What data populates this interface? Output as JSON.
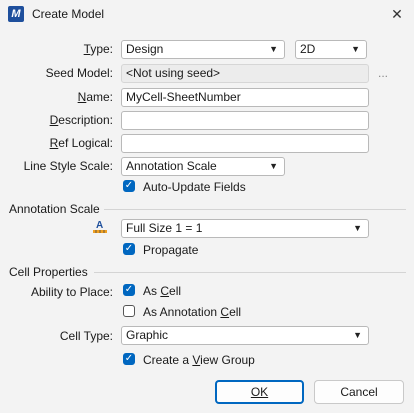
{
  "window": {
    "title": "Create Model",
    "app_icon": "microstation-icon",
    "close_glyph": "✕"
  },
  "fields": {
    "type_label": "Type:",
    "type_value": "Design",
    "dim_value": "2D",
    "seed_label": "Seed Model:",
    "seed_value": "<Not using seed>",
    "seed_browse": "...",
    "name_label": "Name:",
    "name_value": "MyCell-SheetNumber",
    "description_label": "Description:",
    "description_value": "",
    "ref_logical_label": "Ref Logical:",
    "ref_logical_value": "",
    "line_style_label": "Line Style Scale:",
    "line_style_value": "Annotation Scale",
    "auto_update_label": "Auto-Update Fields",
    "auto_update_checked": true
  },
  "annotation": {
    "section_title": "Annotation Scale",
    "icon": "annotation-scale-icon",
    "scale_value": "Full Size 1 = 1",
    "propagate_label": "Propagate",
    "propagate_checked": true
  },
  "cell": {
    "section_title": "Cell Properties",
    "ability_label": "Ability to Place:",
    "as_cell_label": "As Cell",
    "as_cell_checked": true,
    "as_annotation_cell_label": "As Annotation Cell",
    "as_annotation_cell_checked": false,
    "cell_type_label": "Cell Type:",
    "cell_type_value": "Graphic",
    "view_group_label": "Create a View Group",
    "view_group_checked": true
  },
  "buttons": {
    "ok": "OK",
    "cancel": "Cancel"
  },
  "colors": {
    "accent": "#0067c0",
    "background": "#f3f3f3"
  }
}
